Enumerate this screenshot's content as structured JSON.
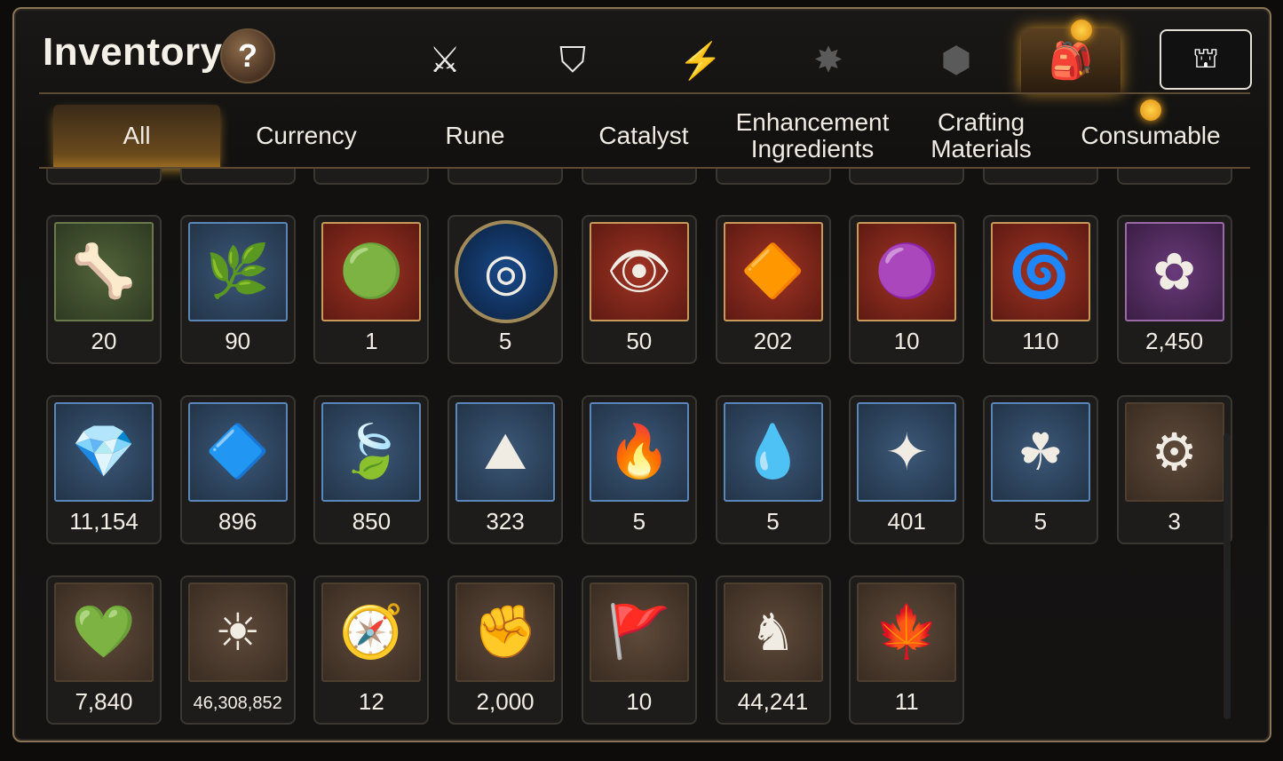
{
  "header": {
    "title": "Inventory",
    "help_label": "?",
    "categories": [
      {
        "name": "equipment",
        "glyph": "⚔"
      },
      {
        "name": "artifact",
        "glyph": "⛉"
      },
      {
        "name": "skill",
        "glyph": "⚡"
      },
      {
        "name": "emblem",
        "glyph": "✸"
      },
      {
        "name": "cube",
        "glyph": "⬢"
      },
      {
        "name": "bag",
        "glyph": "🎒"
      }
    ],
    "store_glyph": "⛫"
  },
  "tabs": [
    {
      "label": "All"
    },
    {
      "label": "Currency"
    },
    {
      "label": "Rune"
    },
    {
      "label": "Catalyst"
    },
    {
      "label": "Enhancement\nIngredients"
    },
    {
      "label": "Crafting\nMaterials"
    },
    {
      "label": "Consumable"
    }
  ],
  "rows": [
    [
      {
        "icon": "claw-icon",
        "glyph": "🦴",
        "bg": "green",
        "count": "20"
      },
      {
        "icon": "root-icon",
        "glyph": "🌿",
        "bg": "blue",
        "count": "90"
      },
      {
        "icon": "green-gem-icon",
        "glyph": "🟢",
        "bg": "red",
        "count": "1"
      },
      {
        "icon": "rune-orb-icon",
        "glyph": "◎",
        "bg": "round",
        "count": "5"
      },
      {
        "icon": "eye-crest-icon",
        "glyph": "👁",
        "bg": "red",
        "count": "50"
      },
      {
        "icon": "crystal-shard-icon",
        "glyph": "🔶",
        "bg": "red",
        "count": "202"
      },
      {
        "icon": "disc-icon",
        "glyph": "🟣",
        "bg": "red",
        "count": "10"
      },
      {
        "icon": "coil-icon",
        "glyph": "🌀",
        "bg": "red",
        "count": "110"
      },
      {
        "icon": "flower-ring-icon",
        "glyph": "✿",
        "bg": "purple",
        "count": "2,450"
      }
    ],
    [
      {
        "icon": "diamond-icon",
        "glyph": "💎",
        "bg": "blue",
        "count": "11,154"
      },
      {
        "icon": "cyan-crystal-icon",
        "glyph": "🔷",
        "bg": "blue",
        "count": "896"
      },
      {
        "icon": "leaf-icon",
        "glyph": "🍃",
        "bg": "blue",
        "count": "850"
      },
      {
        "icon": "pink-ore-icon",
        "glyph": "⛰",
        "bg": "blue",
        "count": "323"
      },
      {
        "icon": "fire-pendant-icon",
        "glyph": "🔥",
        "bg": "blue",
        "count": "5"
      },
      {
        "icon": "water-pendant-icon",
        "glyph": "💧",
        "bg": "blue",
        "count": "5"
      },
      {
        "icon": "star-pendant-icon",
        "glyph": "✦",
        "bg": "blue",
        "count": "401"
      },
      {
        "icon": "clover-pendant-icon",
        "glyph": "☘",
        "bg": "blue",
        "count": "5"
      },
      {
        "icon": "red-seal-icon",
        "glyph": "⚙",
        "bg": "brown",
        "count": "3"
      }
    ],
    [
      {
        "icon": "heart-icon",
        "glyph": "💚",
        "bg": "brown",
        "count": "7,840"
      },
      {
        "icon": "sun-coin-icon",
        "glyph": "☀",
        "bg": "brown",
        "count": "46,308,852",
        "small": true
      },
      {
        "icon": "compass-stone-icon",
        "glyph": "🧭",
        "bg": "brown",
        "count": "12"
      },
      {
        "icon": "fist-emblem-icon",
        "glyph": "✊",
        "bg": "brown",
        "count": "2,000"
      },
      {
        "icon": "war-banner-icon",
        "glyph": "🚩",
        "bg": "brown",
        "count": "10"
      },
      {
        "icon": "knight-piece-icon",
        "glyph": "♞",
        "bg": "brown",
        "count": "44,241"
      },
      {
        "icon": "red-leaf-icon",
        "glyph": "🍁",
        "bg": "brown",
        "count": "11"
      }
    ]
  ]
}
